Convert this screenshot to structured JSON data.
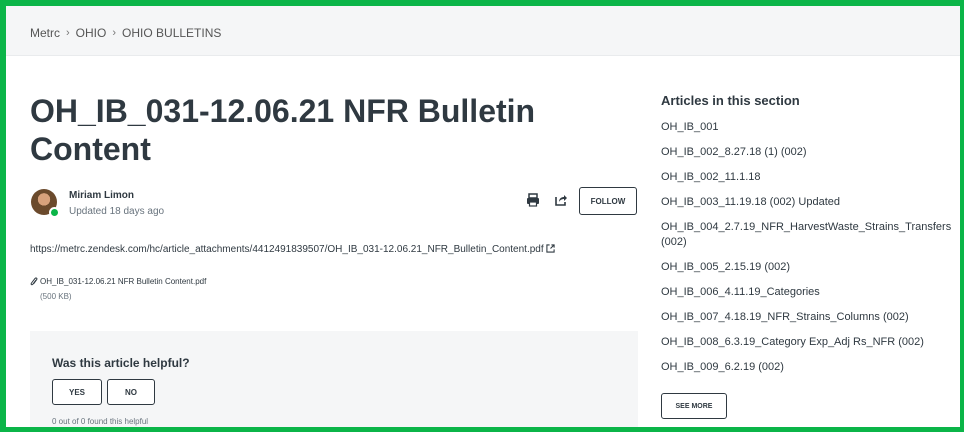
{
  "breadcrumb": [
    "Metrc",
    "OHIO",
    "OHIO BULLETINS"
  ],
  "breadcrumb_separator": "›",
  "article": {
    "title": "OH_IB_031-12.06.21 NFR Bulletin Content",
    "author": "Miriam Limon",
    "updated": "Updated 18 days ago",
    "follow_label": "FOLLOW",
    "attachment_url": "https://metrc.zendesk.com/hc/article_attachments/4412491839507/OH_IB_031-12.06.21_NFR_Bulletin_Content.pdf",
    "attachment_name": "OH_IB_031-12.06.21 NFR Bulletin Content.pdf",
    "attachment_size": "(500 KB)"
  },
  "vote": {
    "question": "Was this article helpful?",
    "yes_label": "YES",
    "no_label": "NO",
    "count_text": "0 out of 0 found this helpful"
  },
  "sidebar": {
    "title": "Articles in this section",
    "items": [
      "OH_IB_001",
      "OH_IB_002_8.27.18 (1) (002)",
      "OH_IB_002_11.1.18",
      "OH_IB_003_11.19.18 (002) Updated",
      "OH_IB_004_2.7.19_NFR_HarvestWaste_Strains_Transfers (002)",
      "OH_IB_005_2.15.19 (002)",
      "OH_IB_006_4.11.19_Categories",
      "OH_IB_007_4.18.19_NFR_Strains_Columns (002)",
      "OH_IB_008_6.3.19_Category Exp_Adj Rs_NFR (002)",
      "OH_IB_009_6.2.19 (002)"
    ],
    "see_more_label": "SEE MORE"
  },
  "icons": [
    "print-icon",
    "share-icon",
    "external-link-icon",
    "paperclip-icon"
  ],
  "colors": {
    "frame": "#0bb548",
    "text": "#2f3941",
    "muted": "#68737d",
    "panel": "#f5f6f7"
  }
}
